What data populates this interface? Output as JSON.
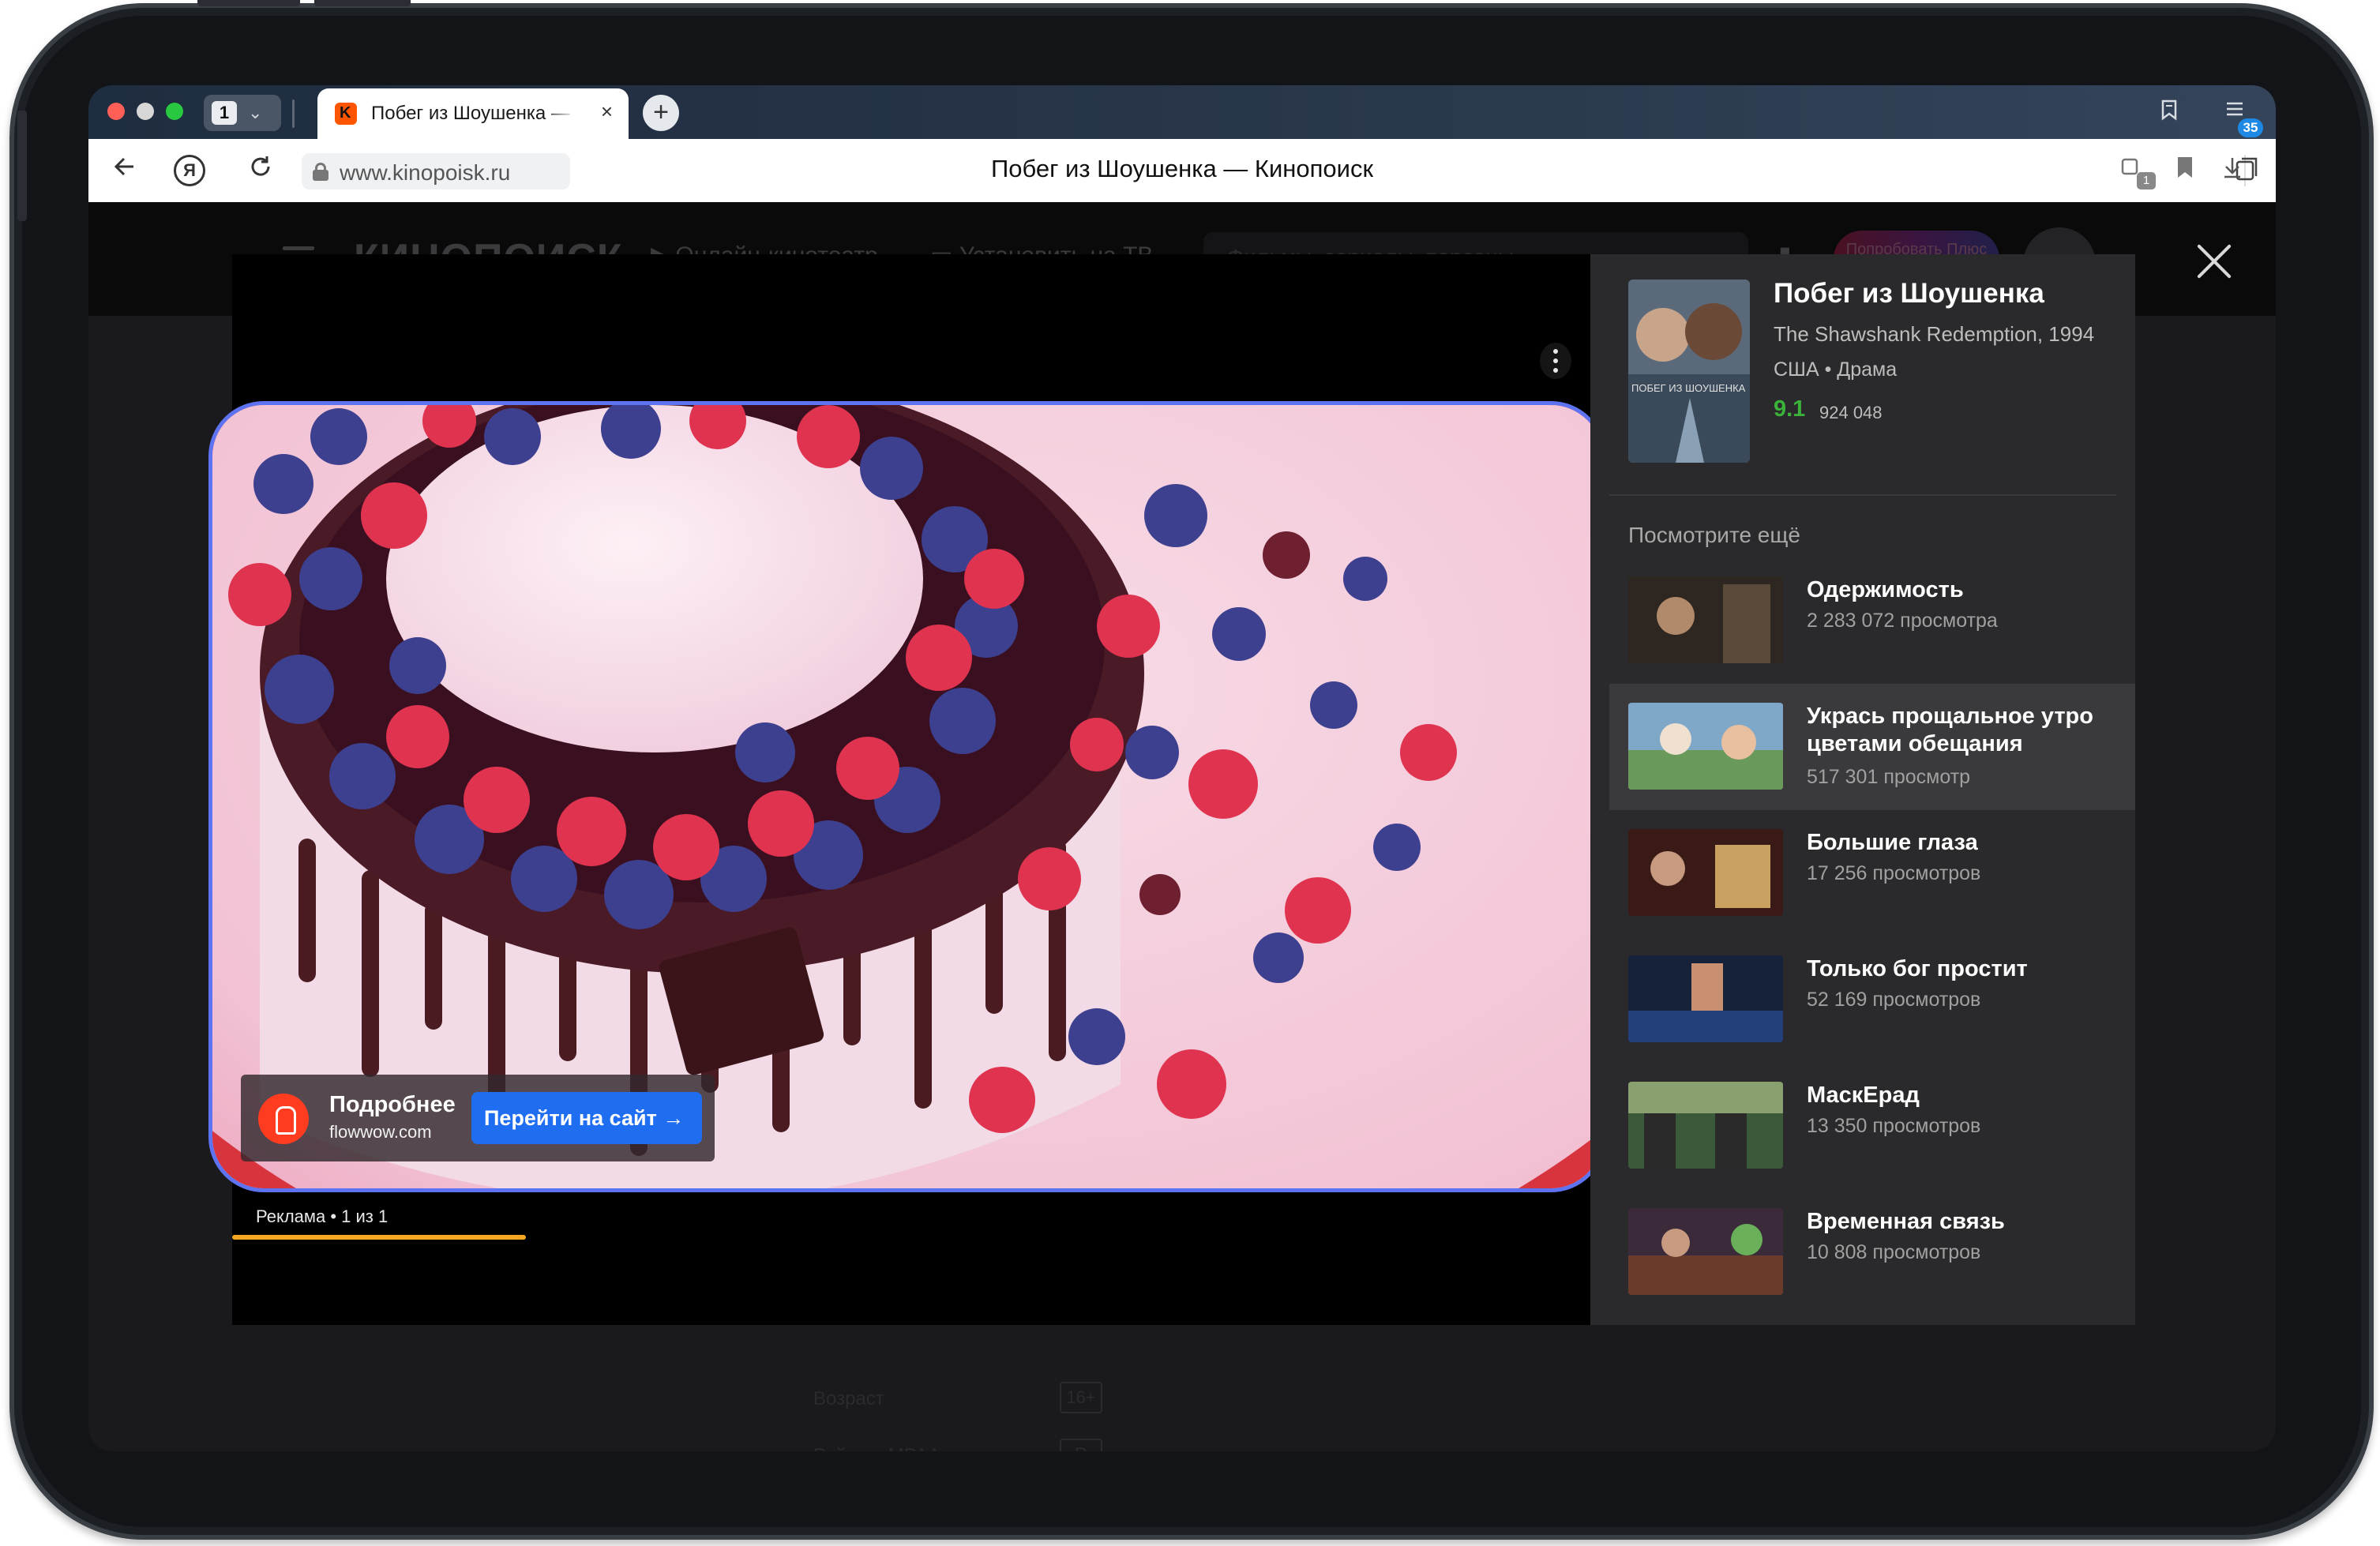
{
  "browser": {
    "tab_count": "1",
    "tab_title": "Побег из Шоушенка — Кинопоиск",
    "url": "www.kinopoisk.ru",
    "page_title": "Побег из Шоушенка — Кинопоиск",
    "tabs_badge": "1",
    "downloads_count": "35"
  },
  "site": {
    "logo": "КИНОПОИСК",
    "nav_online": "Онлайн-кинотеатр",
    "nav_tv": "Установить на ТВ",
    "search_placeholder": "Фильмы, сериалы, персоны",
    "plus_button": "Попробовать Плюс",
    "under_age_label": "Возраст",
    "under_age_value": "16+",
    "under_mpaa_label": "Рейтинг MPAA",
    "under_mpaa_value": "R"
  },
  "ad": {
    "title": "Подробнее",
    "domain": "flowwow.com",
    "cta": "Перейти на сайт →",
    "label": "Реклама • 1 из 1"
  },
  "movie": {
    "title": "Побег из Шоушенка",
    "original": "The Shawshank Redemption, 1994",
    "meta": "США • Драма",
    "rating": "9.1",
    "votes": "924 048",
    "poster_text": "ПОБЕГ ИЗ ШОУШЕНКА"
  },
  "recommendations": {
    "label": "Посмотрите ещё",
    "items": [
      {
        "title": "Одержимость",
        "views": "2 283 072 просмотра"
      },
      {
        "title": "Укрась прощальное утро цветами обещания",
        "views": "517 301 просмотр"
      },
      {
        "title": "Большие глаза",
        "views": "17 256 просмотров"
      },
      {
        "title": "Только бог простит",
        "views": "52 169 просмотров"
      },
      {
        "title": "МаскЕрад",
        "views": "13 350 просмотров"
      },
      {
        "title": "Временная связь",
        "views": "10 808 просмотров"
      }
    ]
  },
  "colors": {
    "accent_blue": "#1f6ef2",
    "video_border": "#5e73f2",
    "rating_green": "#3bb33b",
    "ad_progress": "#f5a623"
  }
}
